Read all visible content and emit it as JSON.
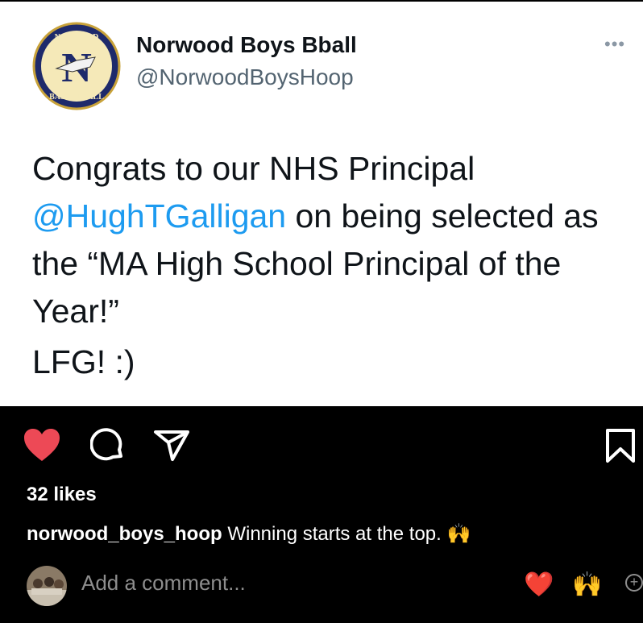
{
  "tweet": {
    "logo": {
      "top_text": "NORWOOD",
      "letter": "N",
      "bottom_text": "BASKETBALL"
    },
    "display_name": "Norwood Boys Bball",
    "handle": "@NorwoodBoysHoop",
    "more_icon": "•••",
    "text_before": "Congrats to our NHS Principal ",
    "mention": "@HughTGalligan",
    "text_after": " on being selected as the “MA High School Principal of the Year!”",
    "text_line2": "LFG! :)"
  },
  "post": {
    "likes": "32 likes",
    "username": "norwood_boys_hoop",
    "caption": " Winning starts at the top. ",
    "caption_emoji": "🙌",
    "comment_placeholder": "Add a comment...",
    "quick_emojis": [
      "❤️",
      "🙌"
    ],
    "add_symbol": "+",
    "colors": {
      "like": "#ed4956",
      "mention": "#1d9bf0",
      "bg": "#000000"
    }
  }
}
